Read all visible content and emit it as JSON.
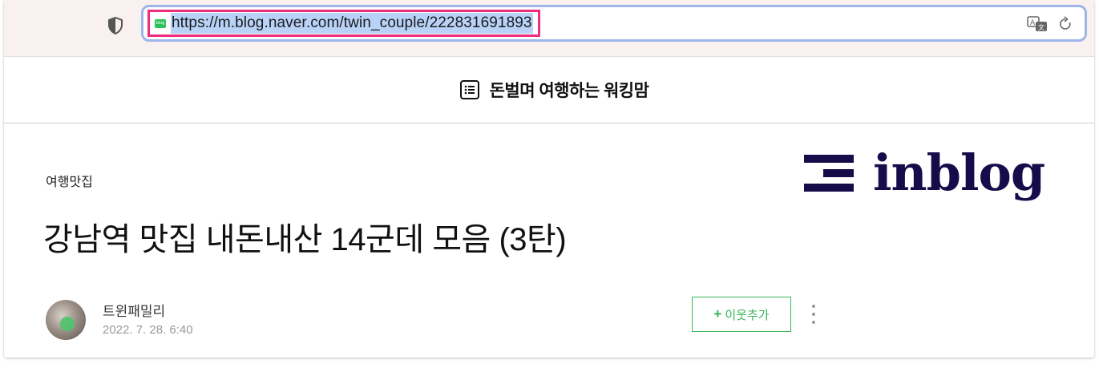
{
  "browser": {
    "url": "https://m.blog.naver.com/twin_couple/222831691893",
    "favicon_label": "blog",
    "highlight_color": "#ee2d7e",
    "selection_color": "#b8d2f8"
  },
  "blog": {
    "title": "돈벌며 여행하는 워킹맘"
  },
  "post": {
    "category": "여행맛집",
    "title": "강남역 맛집 내돈내산 14군데 모음 (3탄)",
    "author": "트윈패밀리",
    "date": "2022. 7. 28. 6:40",
    "follow_label": "이웃추가",
    "follow_plus": "+",
    "accent_color": "#38b65a"
  },
  "brand": {
    "name": "inblog",
    "color": "#170c4a"
  },
  "icons": {
    "shield": "shield-icon",
    "translate": "translate-icon",
    "reload": "reload-icon",
    "list": "list-icon",
    "more": "more-vertical-icon"
  }
}
